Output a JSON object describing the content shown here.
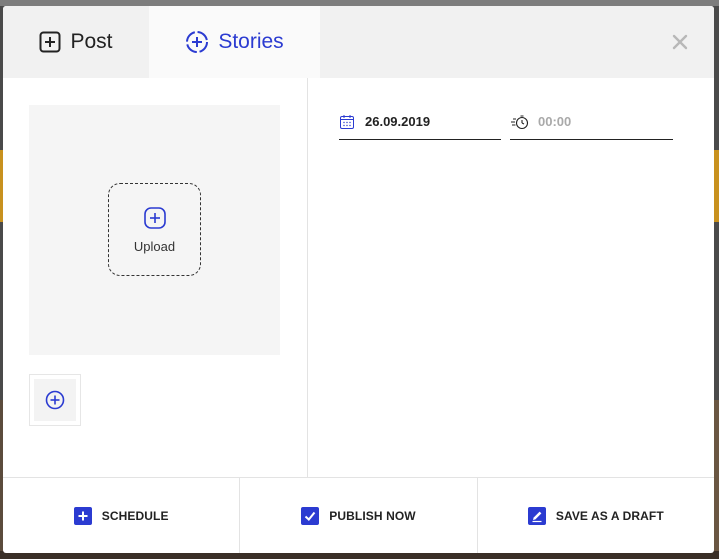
{
  "tabs": {
    "post_label": "Post",
    "stories_label": "Stories",
    "active": "stories"
  },
  "media": {
    "upload_label": "Upload"
  },
  "schedule": {
    "date_value": "26.09.2019",
    "time_placeholder": "00:00"
  },
  "footer": {
    "schedule_label": "SCHEDULE",
    "publish_label": "PUBLISH NOW",
    "draft_label": "SAVE AS A DRAFT"
  },
  "icons": {
    "post_tab": "plus-square-icon",
    "stories_tab": "plus-circle-dashed-icon",
    "close": "close-icon",
    "upload": "plus-rounded-square-icon",
    "add_media": "plus-circle-icon",
    "date": "calendar-icon",
    "time": "stopwatch-icon",
    "schedule": "plus-square-filled-icon",
    "publish": "checkbox-checked-icon",
    "draft": "edit-icon"
  },
  "colors": {
    "accent": "#2b3bd1",
    "tab_bar_bg": "#f1f1f1",
    "upload_area_bg": "#f5f5f5"
  }
}
